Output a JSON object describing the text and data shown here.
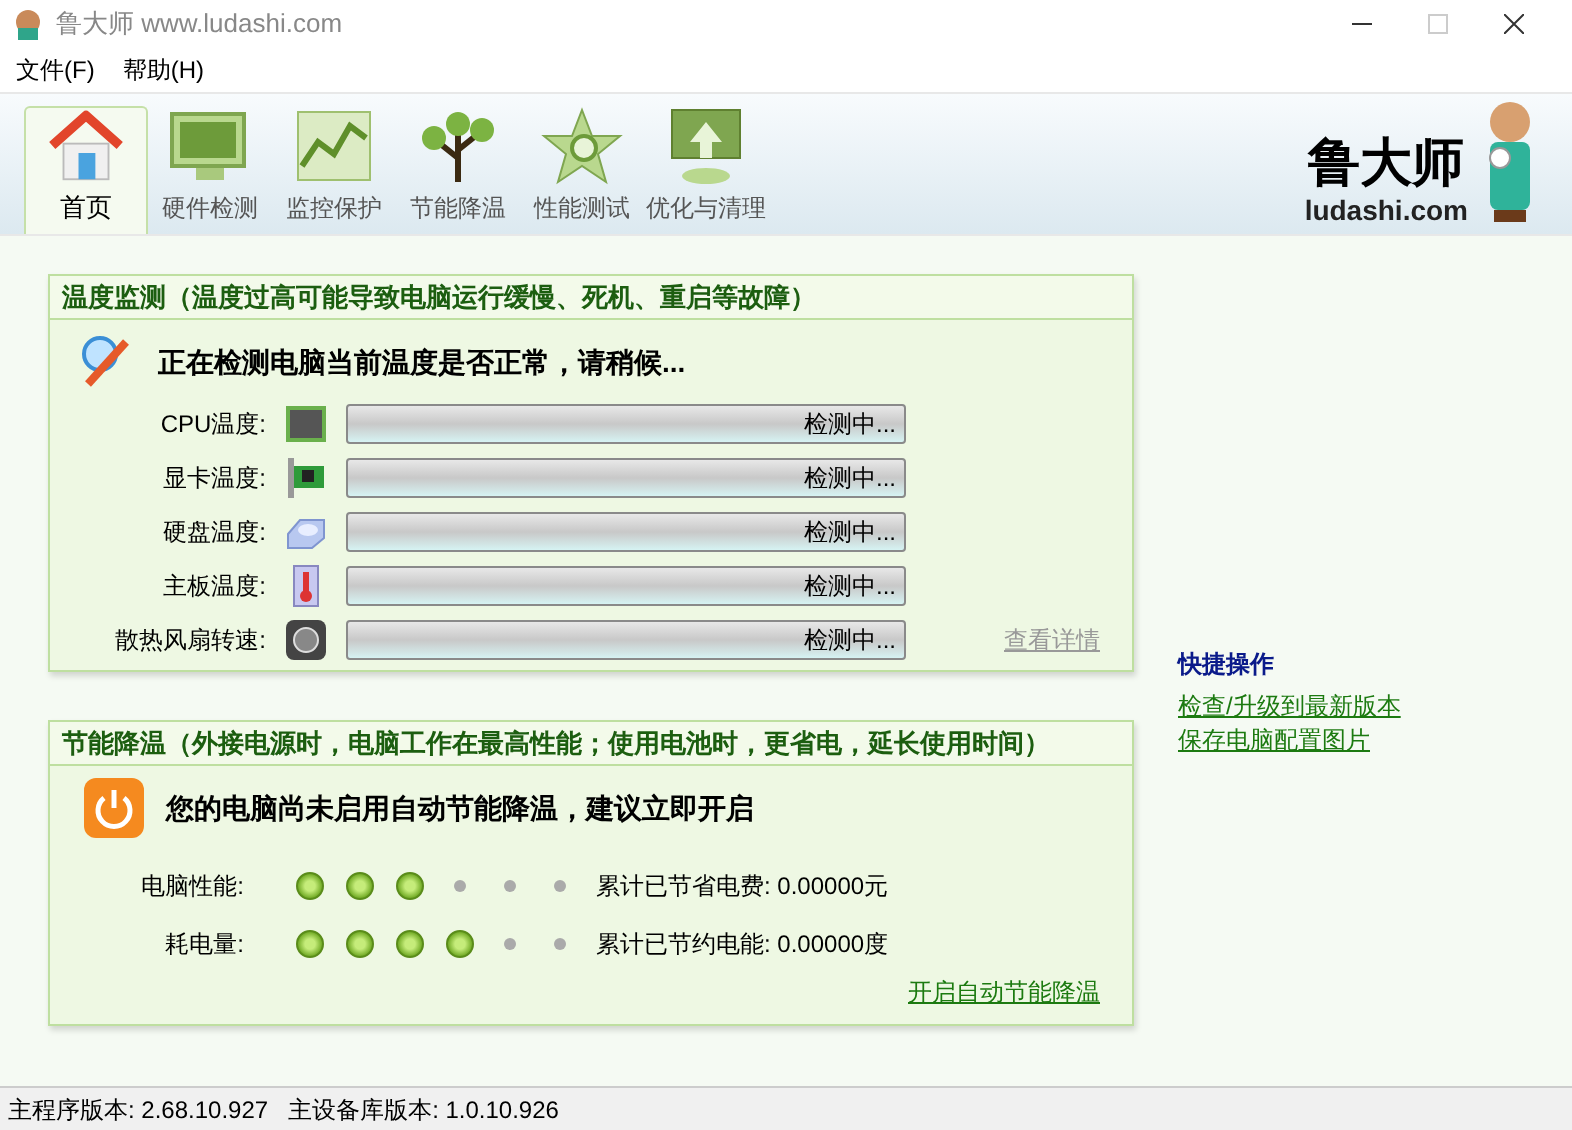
{
  "window": {
    "title": "鲁大师 www.ludashi.com"
  },
  "menu": [
    "文件(F)",
    "帮助(H)"
  ],
  "tabs": [
    {
      "label": "首页",
      "selected": true,
      "kind": "home"
    },
    {
      "label": "硬件检测",
      "selected": false,
      "kind": "monitor"
    },
    {
      "label": "监控保护",
      "selected": false,
      "kind": "chart"
    },
    {
      "label": "节能降温",
      "selected": false,
      "kind": "tree"
    },
    {
      "label": "性能测试",
      "selected": false,
      "kind": "star"
    },
    {
      "label": "优化与清理",
      "selected": false,
      "kind": "upload"
    }
  ],
  "logo": {
    "name": "鲁大师",
    "site": "ludashi.com"
  },
  "temperature_panel": {
    "title": "温度监测（温度过高可能导致电脑运行缓慢、死机、重启等故障）",
    "message": "正在检测电脑当前温度是否正常，请稍候...",
    "sensors": [
      {
        "label": "CPU温度:",
        "kind": "cpu",
        "level": 0,
        "reading": "检测中..."
      },
      {
        "label": "显卡温度:",
        "kind": "gpu",
        "level": 0,
        "reading": "检测中..."
      },
      {
        "label": "硬盘温度:",
        "kind": "disk",
        "level": 0,
        "reading": "检测中..."
      },
      {
        "label": "主板温度:",
        "kind": "thermo",
        "level": 0,
        "reading": "检测中..."
      },
      {
        "label": "散热风扇转速:",
        "kind": "fan",
        "level": 0,
        "reading": "检测中..."
      }
    ],
    "details_link": "查看详情"
  },
  "energy_panel": {
    "title": "节能降温（外接电源时，电脑工作在最高性能；使用电池时，更省电，延长使用时间）",
    "message": "您的电脑尚未启用自动节能降温，建议立即开启",
    "meters": [
      {
        "label": "电脑性能:",
        "stars": 3,
        "note": "累计已节省电费: 0.00000元"
      },
      {
        "label": "耗电量:",
        "stars": 4,
        "note": "累计已节约电能: 0.00000度"
      }
    ],
    "enable_link": "开启自动节能降温"
  },
  "quick_actions": {
    "title": "快捷操作",
    "links": [
      "检查/升级到最新版本",
      "保存电脑配置图片"
    ]
  },
  "status_bar": [
    "主程序版本: 2.68.10.927",
    "主设备库版本: 1.0.10.926"
  ]
}
